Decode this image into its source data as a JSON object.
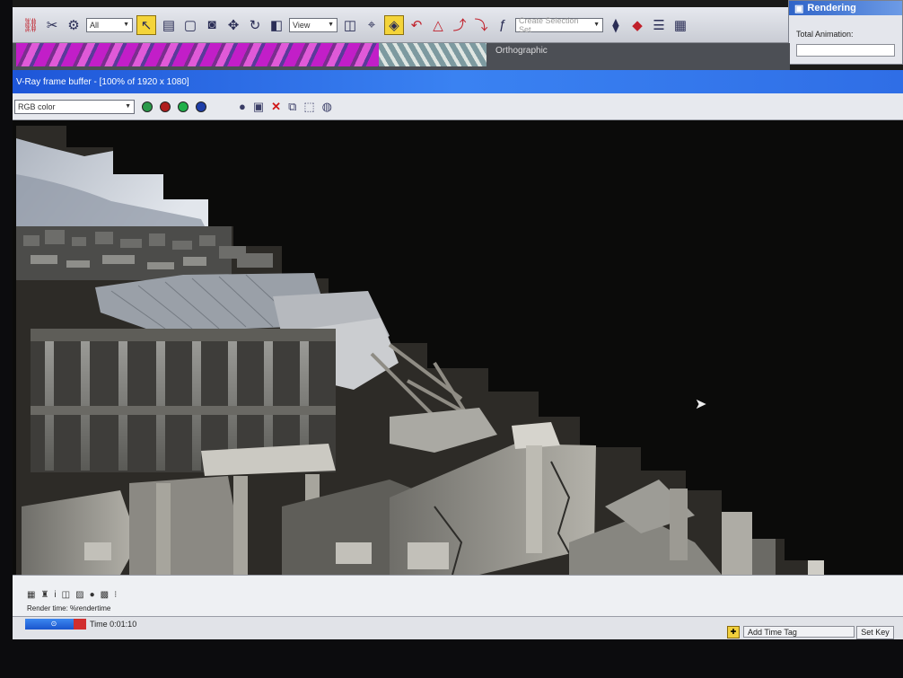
{
  "toolbar": {
    "filter_value": "All",
    "view_value": "View",
    "selection_set_placeholder": "Create Selection Set",
    "icons": [
      "link-icon",
      "unlink-icon",
      "bind-icon",
      "select-icon",
      "select-by-name-icon",
      "rect-select-icon",
      "window-crossing-icon",
      "move-icon",
      "rotate-icon",
      "scale-icon",
      "pivot-icon",
      "snap-icon",
      "angle-snap-icon",
      "percent-snap-icon",
      "spinner-snap-icon",
      "named-sets-icon",
      "mirror-icon",
      "align-icon",
      "layers-icon",
      "curve-editor-icon"
    ]
  },
  "render_panel": {
    "title": "Rendering",
    "total_animation_label": "Total Animation:"
  },
  "viewport": {
    "label": "Orthographic"
  },
  "frame_buffer": {
    "title": "V-Ray frame buffer - [100% of 1920 x 1080]",
    "channel_value": "RGB color",
    "channel_dots": [
      "#2a9a4a",
      "#b01e1e",
      "#1fb04a",
      "#1e3ea8"
    ],
    "tool_icons": [
      "save-icon",
      "clear-icon",
      "compare-icon",
      "region-icon",
      "render-icon",
      "stamp-icon"
    ]
  },
  "status": {
    "render_time_label": "Render time: %rendertime",
    "time_label": "Time  0:01:10",
    "add_time_tag_label": "Add Time Tag",
    "set_key_label": "Set Key"
  },
  "colors": {
    "title_blue": "#2f6ee6",
    "highlight_yellow": "#f4d43a",
    "render_background": "#0b0b0a"
  }
}
